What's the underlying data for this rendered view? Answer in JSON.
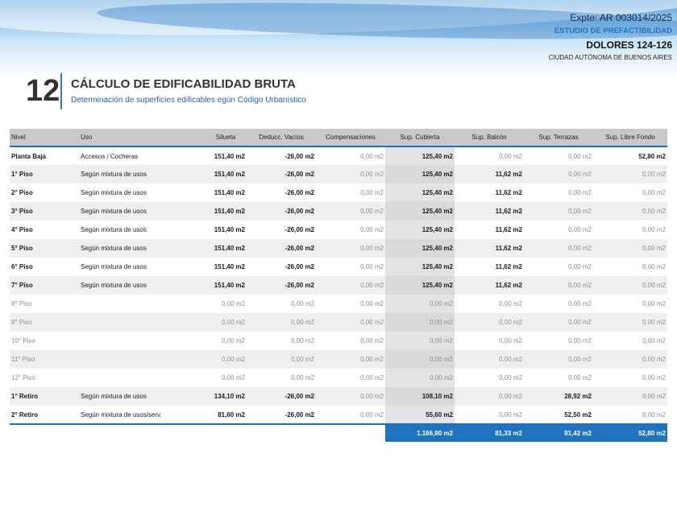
{
  "header": {
    "expte": "Expte: AR 003014/2025",
    "estudio": "ESTUDIO DE PREFACTIBILIDAD",
    "address": "DOLORES 124-126",
    "city": "CIUDAD AUTÓNOMA DE BUENOS AIRES"
  },
  "section": {
    "number": "12",
    "title": "CÁLCULO DE EDIFICABILIDAD BRUTA",
    "subtitle": "Determinación de superficies edificables egún Código Urbanístico"
  },
  "table": {
    "columns": [
      "Nivel",
      "Uso",
      "Silueta",
      "Deducc. Vacíos",
      "Compensaciones",
      "Sup. Cubierta",
      "Sup. Balcón",
      "Sup. Terrazas",
      "Sup. Libre Fondo"
    ],
    "rows": [
      {
        "nivel": "Planta Baja",
        "uso": "Accesos / Cocheras",
        "silueta": "151,40 m2",
        "deducc": "-26,00 m2",
        "comp": "0,00 m2",
        "cubierta": "125,40 m2",
        "balcon": "0,00 m2",
        "terrazas": "0,00 m2",
        "libre": "52,80 m2"
      },
      {
        "nivel": "1° Piso",
        "uso": "Según mixtura de usos",
        "silueta": "151,40 m2",
        "deducc": "-26,00 m2",
        "comp": "0,00 m2",
        "cubierta": "125,40 m2",
        "balcon": "11,62 m2",
        "terrazas": "0,00 m2",
        "libre": "0,00 m2"
      },
      {
        "nivel": "2° Piso",
        "uso": "Según mixtura de usos",
        "silueta": "151,40 m2",
        "deducc": "-26,00 m2",
        "comp": "0,00 m2",
        "cubierta": "125,40 m2",
        "balcon": "11,62 m2",
        "terrazas": "0,00 m2",
        "libre": "0,00 m2"
      },
      {
        "nivel": "3° Piso",
        "uso": "Según mixtura de usos",
        "silueta": "151,40 m2",
        "deducc": "-26,00 m2",
        "comp": "0,00 m2",
        "cubierta": "125,40 m2",
        "balcon": "11,62 m2",
        "terrazas": "0,00 m2",
        "libre": "0,00 m2"
      },
      {
        "nivel": "4° Piso",
        "uso": "Según mixtura de usos",
        "silueta": "151,40 m2",
        "deducc": "-26,00 m2",
        "comp": "0,00 m2",
        "cubierta": "125,40 m2",
        "balcon": "11,62 m2",
        "terrazas": "0,00 m2",
        "libre": "0,00 m2"
      },
      {
        "nivel": "5° Piso",
        "uso": "Según mixtura de usos",
        "silueta": "151,40 m2",
        "deducc": "-26,00 m2",
        "comp": "0,00 m2",
        "cubierta": "125,40 m2",
        "balcon": "11,62 m2",
        "terrazas": "0,00 m2",
        "libre": "0,00 m2"
      },
      {
        "nivel": "6° Piso",
        "uso": "Según mixtura de usos",
        "silueta": "151,40 m2",
        "deducc": "-26,00 m2",
        "comp": "0,00 m2",
        "cubierta": "125,40 m2",
        "balcon": "11,62 m2",
        "terrazas": "0,00 m2",
        "libre": "0,00 m2"
      },
      {
        "nivel": "7° Piso",
        "uso": "Según mixtura de usos",
        "silueta": "151,40 m2",
        "deducc": "-26,00 m2",
        "comp": "0,00 m2",
        "cubierta": "125,40 m2",
        "balcon": "11,62 m2",
        "terrazas": "0,00 m2",
        "libre": "0,00 m2"
      },
      {
        "nivel": "8° Piso",
        "uso": "",
        "silueta": "0,00 m2",
        "deducc": "0,00 m2",
        "comp": "0,00 m2",
        "cubierta": "0,00 m2",
        "balcon": "0,00 m2",
        "terrazas": "0,00 m2",
        "libre": "0,00 m2"
      },
      {
        "nivel": "9° Piso",
        "uso": "",
        "silueta": "0,00 m2",
        "deducc": "0,00 m2",
        "comp": "0,00 m2",
        "cubierta": "0,00 m2",
        "balcon": "0,00 m2",
        "terrazas": "0,00 m2",
        "libre": "0,00 m2"
      },
      {
        "nivel": "10° Piso",
        "uso": "",
        "silueta": "0,00 m2",
        "deducc": "0,00 m2",
        "comp": "0,00 m2",
        "cubierta": "0,00 m2",
        "balcon": "0,00 m2",
        "terrazas": "0,00 m2",
        "libre": "0,00 m2"
      },
      {
        "nivel": "11° Piso",
        "uso": "",
        "silueta": "0,00 m2",
        "deducc": "0,00 m2",
        "comp": "0,00 m2",
        "cubierta": "0,00 m2",
        "balcon": "0,00 m2",
        "terrazas": "0,00 m2",
        "libre": "0,00 m2"
      },
      {
        "nivel": "12° Piso",
        "uso": "",
        "silueta": "0,00 m2",
        "deducc": "0,00 m2",
        "comp": "0,00 m2",
        "cubierta": "0,00 m2",
        "balcon": "0,00 m2",
        "terrazas": "0,00 m2",
        "libre": "0,00 m2"
      },
      {
        "nivel": "1° Retiro",
        "uso": "Según mixtura de usos",
        "silueta": "134,10 m2",
        "deducc": "-26,00 m2",
        "comp": "0,00 m2",
        "cubierta": "108,10 m2",
        "balcon": "0,00 m2",
        "terrazas": "28,92 m2",
        "libre": "0,00 m2"
      },
      {
        "nivel": "2° Retiro",
        "uso": "Según mixtura de usos/serv.",
        "silueta": "81,60 m2",
        "deducc": "-26,00 m2",
        "comp": "0,00 m2",
        "cubierta": "55,60 m2",
        "balcon": "0,00 m2",
        "terrazas": "52,50 m2",
        "libre": "0,00 m2"
      }
    ],
    "totals": {
      "cubierta": "1.166,90 m2",
      "balcon": "81,33 m2",
      "terrazas": "81,42 m2",
      "libre": "52,80 m2"
    }
  },
  "colors": {
    "accent": "#1f73bf",
    "header_grey": "#c9c9c9",
    "muted_text": "#8c8c8c"
  }
}
